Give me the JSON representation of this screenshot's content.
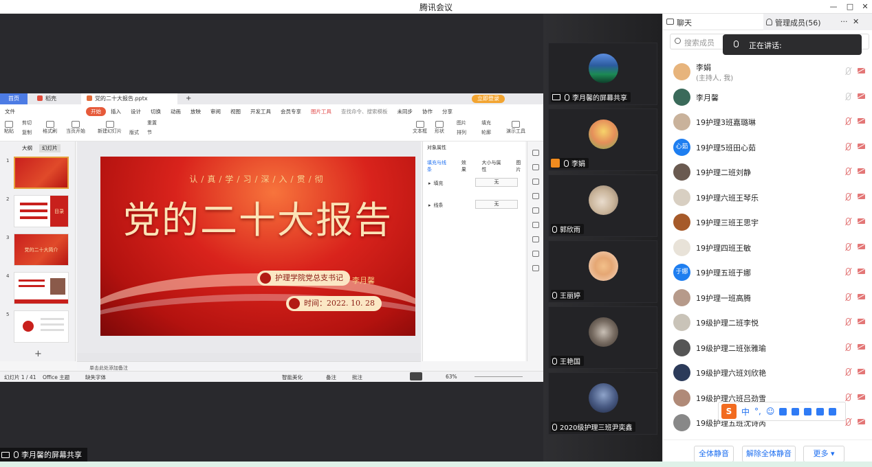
{
  "window": {
    "title": "腾讯会议",
    "controls": [
      "—",
      "□",
      "✕"
    ]
  },
  "stage": {
    "share_label": "李月馨的屏幕共享"
  },
  "ppt": {
    "tabs": {
      "home": "首页",
      "wps": "稻壳",
      "doc": "党的二十大报告.pptx"
    },
    "menu": [
      "文件",
      "开始",
      "插入",
      "设计",
      "切换",
      "动画",
      "放映",
      "审阅",
      "视图",
      "开发工具",
      "会员专享",
      "图片工具"
    ],
    "menu_search": "查找命令、搜索模板",
    "menu_right": [
      "未同步",
      "协作",
      "分享"
    ],
    "login_label": "立即登录",
    "ribbon": [
      "粘贴",
      "剪切",
      "复制",
      "格式刷",
      "当页开始",
      "新建幻灯片",
      "版式",
      "节",
      "重置",
      "文本框",
      "形状",
      "图片",
      "排列",
      "轮廓",
      "填充",
      "演示工具"
    ],
    "outline_tabs": [
      "大纲",
      "幻灯片"
    ],
    "thumb_numbers": [
      "1",
      "2",
      "3",
      "4",
      "5"
    ],
    "thumb_captions": {
      "t2": "目录",
      "t3": "党的二十大简介"
    },
    "slide": {
      "subtitle": "认/真/学/习/深/入/贯/彻",
      "title": "党的二十大报告",
      "presenter_role": "护理学院党总支书记",
      "presenter_name": "李月馨",
      "date": "时间：2022. 10. 28"
    },
    "props": {
      "header": "对象属性",
      "tabs": [
        "填充与线条",
        "效果",
        "大小与属性",
        "图片"
      ],
      "fill_label": "填充",
      "fill_value": "无",
      "line_label": "线条",
      "line_value": "无"
    },
    "notes_placeholder": "单击此处添加备注",
    "status": {
      "slide_count": "幻灯片 1 / 41",
      "theme": "Office 主题",
      "font": "缺失字体",
      "beautify": "智能美化",
      "notes": "备注",
      "comments": "批注",
      "zoom": "63%"
    }
  },
  "tiles": [
    {
      "name": "李月馨的屏幕共享"
    },
    {
      "name": "李娟"
    },
    {
      "name": "郭欣雨"
    },
    {
      "name": "王丽婷"
    },
    {
      "name": "王艳国"
    },
    {
      "name": "2020级护理三班尹奕鑫"
    }
  ],
  "panel": {
    "chat_tab": "聊天",
    "members_tab": "管理成员(56)",
    "search_placeholder": "搜索成员",
    "speaking_label": "正在讲话:",
    "members": [
      {
        "name": "李娟",
        "sub": "(主持人, 我)",
        "avatar": "#e7b47c"
      },
      {
        "name": "李月馨",
        "avatar": "#3a6a5a"
      },
      {
        "name": "19护理3班嘉璐琳",
        "avatar": "#c9b29b"
      },
      {
        "name": "19护理5班田心茹",
        "avatar": "#1e7ef0",
        "initials": "心茹"
      },
      {
        "name": "19护理二班刘静",
        "avatar": "#6a5a50"
      },
      {
        "name": "19护理六班王琴乐",
        "avatar": "#d8cfc2"
      },
      {
        "name": "19护理三班王思宇",
        "avatar": "#a65a2a"
      },
      {
        "name": "19护理四班王敏",
        "avatar": "#e8e2d8"
      },
      {
        "name": "19护理五班于娜",
        "avatar": "#1e7ef0",
        "initials": "于娜"
      },
      {
        "name": "19护理一班高腾",
        "avatar": "#b69a8a"
      },
      {
        "name": "19级护理二班李悦",
        "avatar": "#c9c3b8"
      },
      {
        "name": "19级护理二班张雅瑜",
        "avatar": "#555"
      },
      {
        "name": "19级护理六班刘欣艳",
        "avatar": "#2c3b5a"
      },
      {
        "name": "19级护理六班吕劲雪",
        "avatar": "#b08a78"
      },
      {
        "name": "19级护理五班沈诗芮",
        "avatar": "#888"
      }
    ],
    "ime_lang": "中",
    "buttons": {
      "mute_all": "全体静音",
      "unmute_all": "解除全体静音",
      "more": "更多 ▾"
    }
  }
}
